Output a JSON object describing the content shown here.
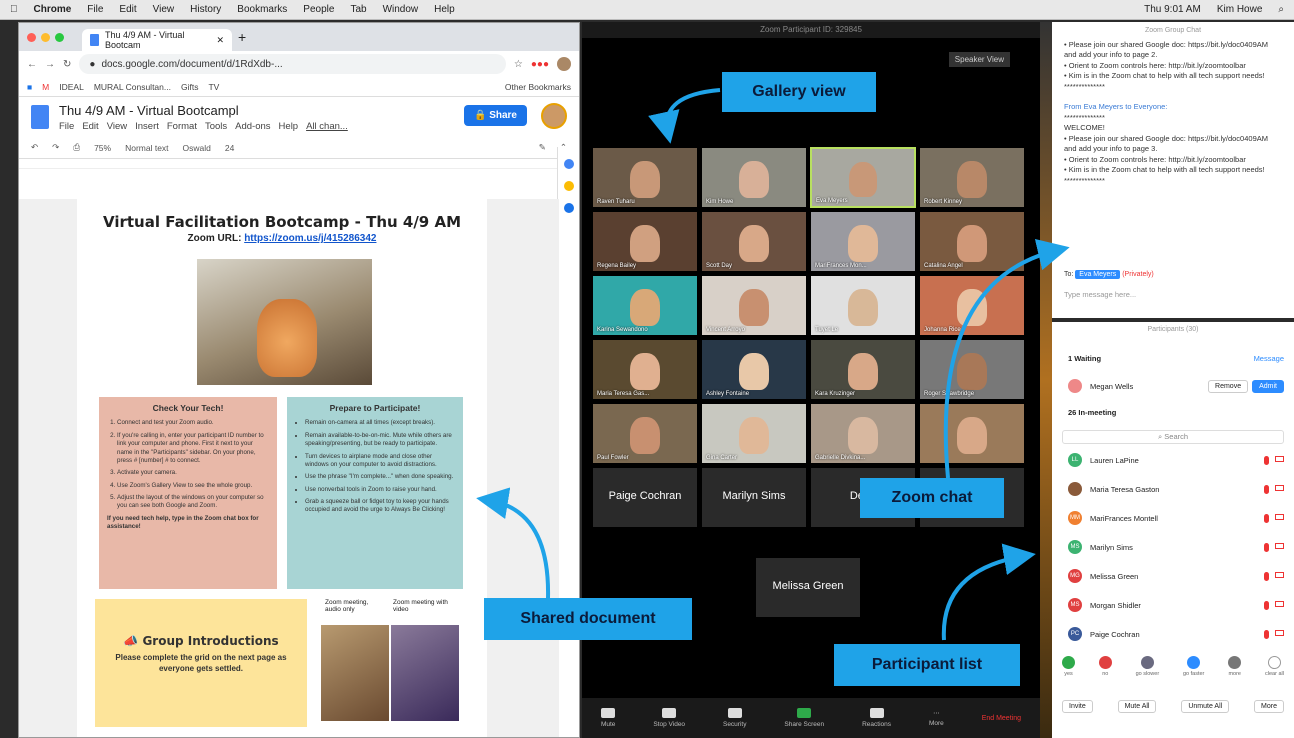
{
  "menubar": {
    "app": "Chrome",
    "items": [
      "File",
      "Edit",
      "View",
      "History",
      "Bookmarks",
      "People",
      "Tab",
      "Window",
      "Help"
    ],
    "clock": "Thu 9:01 AM",
    "user": "Kim Howe"
  },
  "browser": {
    "tab_title": "Thu 4/9 AM - Virtual Bootcam",
    "url": "docs.google.com/document/d/1RdXdb-...",
    "bookmarks": [
      "IDEAL",
      "MURAL Consultan...",
      "Gifts",
      "TV",
      "Other Bookmarks"
    ]
  },
  "doc": {
    "title": "Thu 4/9 AM - Virtual Bootcampl",
    "menu": [
      "File",
      "Edit",
      "View",
      "Insert",
      "Format",
      "Tools",
      "Add-ons",
      "Help",
      "All chan..."
    ],
    "share": "Share",
    "toolbar": [
      "75%",
      "Normal text",
      "Oswald",
      "24"
    ],
    "heading": "Virtual Facilitation Bootcamp - Thu 4/9 AM",
    "zoom_label": "Zoom URL:",
    "zoom_link": "https://zoom.us/j/415286342",
    "box1": {
      "title": "Check Your Tech!",
      "items": [
        "Connect and test your Zoom audio.",
        "If you're calling in, enter your participant ID number to link your computer and phone. First it next to your name in the \"Participants\" sidebar. On your phone, press # [number] # to connect.",
        "Activate your camera.",
        "Use Zoom's Gallery View to see the whole group.",
        "Adjust the layout of the windows on your computer so you can see both Google and Zoom."
      ],
      "footer": "If you need tech help, type in the Zoom chat box for assistance!"
    },
    "box2": {
      "title": "Prepare to Participate!",
      "items": [
        "Remain on-camera at all times (except breaks).",
        "Remain available-to-be-on-mic. Mute while others are speaking/presenting, but be ready to participate.",
        "Turn devices to airplane mode and close other windows on your computer to avoid distractions.",
        "Use the phrase \"I'm complete...\" when done speaking.",
        "Use nonverbal tools in Zoom to raise your hand.",
        "Grab a squeeze ball or fidget toy to keep your hands occupied and avoid the urge to Always Be Clicking!"
      ]
    },
    "box3": {
      "title": "Group Introductions",
      "text": "Please complete the grid on the next page as everyone gets settled."
    },
    "dog_labels": [
      "Zoom meeting, audio only",
      "Zoom meeting with video"
    ]
  },
  "zoom": {
    "window_title": "Zoom Participant ID: 329845",
    "speaker_view": "Speaker View",
    "tiles": [
      {
        "name": "Raven Tuharu",
        "bg": "#6b5a48",
        "face": "#c89878"
      },
      {
        "name": "Kim Howe",
        "bg": "#8a8a80",
        "face": "#d8b098"
      },
      {
        "name": "Eva Meyers",
        "bg": "#a8a8a0",
        "face": "#c89878"
      },
      {
        "name": "Robert Kinney",
        "bg": "#7a7060",
        "face": "#b88868"
      },
      {
        "name": "Regena Bailey",
        "bg": "#5a4030",
        "face": "#d0a080"
      },
      {
        "name": "Scott Day",
        "bg": "#6a5040",
        "face": "#d8a888"
      },
      {
        "name": "MariFrances Mon...",
        "bg": "#9a9aa0",
        "face": "#e0b898"
      },
      {
        "name": "Catalina Angel",
        "bg": "#7a5a40",
        "face": "#d09878"
      },
      {
        "name": "Karina Sewandono",
        "bg": "#30a8a8",
        "face": "#d8a878"
      },
      {
        "name": "Vincent Arroyo",
        "bg": "#d8d0c8",
        "face": "#c89070"
      },
      {
        "name": "Tuyet Le",
        "bg": "#e0e0e0",
        "face": "#d8b898"
      },
      {
        "name": "Johanna Rice",
        "bg": "#c87050",
        "face": "#e8c0a0"
      },
      {
        "name": "Maria Teresa Gas...",
        "bg": "#5a4a30",
        "face": "#e0b090"
      },
      {
        "name": "Ashley Fontaine",
        "bg": "#283848",
        "face": "#e8c8a8"
      },
      {
        "name": "Kara Kruzinger",
        "bg": "#4a4a40",
        "face": "#d8a888"
      },
      {
        "name": "Roger Strawbridge",
        "bg": "#787878",
        "face": "#a87858"
      },
      {
        "name": "Paul Fowler",
        "bg": "#7a6850",
        "face": "#c89070"
      },
      {
        "name": "Gina Carter",
        "bg": "#c8c8c0",
        "face": "#e0b898"
      },
      {
        "name": "Gabrielle Divkina...",
        "bg": "#a89888",
        "face": "#d8b8a0"
      },
      {
        "name": "",
        "bg": "#9a7a5a",
        "face": "#d8a888"
      }
    ],
    "text_tiles": [
      "Paige Cochran",
      "Marilyn Sims",
      "Dena",
      "ne",
      "Melissa Green"
    ],
    "controls": [
      "Mute",
      "Stop Video",
      "Security",
      "Share Screen",
      "Reactions",
      "More"
    ],
    "end": "End Meeting"
  },
  "chat": {
    "title": "Zoom Group Chat",
    "msg1": [
      "• Please join our shared Google doc: https://bit.ly/doc0409AM and add your info to page 2.",
      "• Orient to Zoom controls here: http://bit.ly/zoomtoolbar",
      "• Kim is in the Zoom chat to help with all tech support needs!",
      "**************"
    ],
    "from": "From Eva Meyers to Everyone:",
    "msg2": [
      "**************",
      "WELCOME!",
      "• Please join our shared Google doc: https://bit.ly/doc0409AM and add your info to page 3.",
      "• Orient to Zoom controls here: http://bit.ly/zoomtoolbar",
      "• Kim is in the Zoom chat to help with all tech support needs!",
      "**************"
    ],
    "to_label": "To:",
    "to": "Eva Meyers",
    "privately": "(Privately)",
    "placeholder": "Type message here..."
  },
  "participants": {
    "title": "Participants (30)",
    "waiting": "1 Waiting",
    "message": "Message",
    "waiting_name": "Megan Wells",
    "remove": "Remove",
    "admit": "Admit",
    "in_meeting": "26 In-meeting",
    "search": "Search",
    "list": [
      {
        "name": "Lauren LaPine",
        "color": "#3cb371",
        "initials": "LL"
      },
      {
        "name": "Maria Teresa Gaston",
        "color": "#8a5a3a",
        "initials": ""
      },
      {
        "name": "MariFrances Montell",
        "color": "#f08030",
        "initials": "MM"
      },
      {
        "name": "Marilyn Sims",
        "color": "#3cb371",
        "initials": "MS"
      },
      {
        "name": "Melissa Green",
        "color": "#e04040",
        "initials": "MG"
      },
      {
        "name": "Morgan Shidler",
        "color": "#e04040",
        "initials": "MS"
      },
      {
        "name": "Paige Cochran",
        "color": "#3a5a9a",
        "initials": "PC"
      }
    ],
    "reactions": [
      {
        "label": "yes",
        "color": "#2eaa4a"
      },
      {
        "label": "no",
        "color": "#e04040"
      },
      {
        "label": "go slower",
        "color": "#6a6a80"
      },
      {
        "label": "go faster",
        "color": "#2d8cff"
      },
      {
        "label": "more",
        "color": "#777"
      },
      {
        "label": "clear all",
        "color": "#fff"
      }
    ],
    "footer": [
      "Invite",
      "Mute All",
      "Unmute All",
      "More"
    ]
  },
  "callouts": [
    "Gallery view",
    "Zoom chat",
    "Shared document",
    "Participant list"
  ]
}
